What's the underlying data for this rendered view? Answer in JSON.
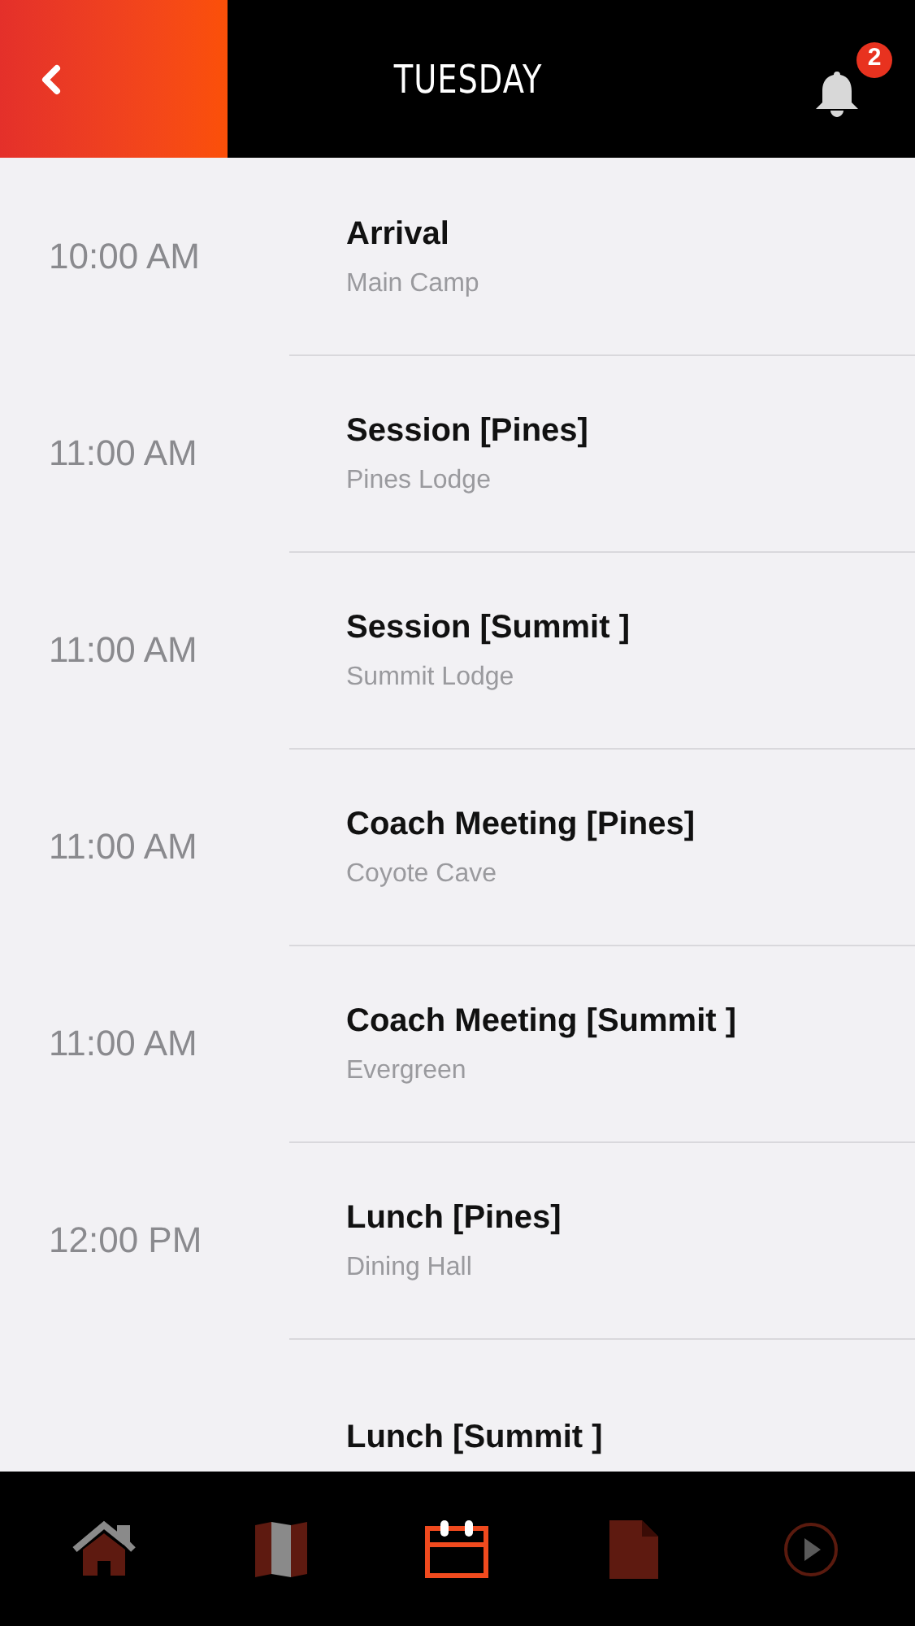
{
  "header": {
    "title": "TUESDAY",
    "notification_count": "2"
  },
  "events": [
    {
      "time": "10:00 AM",
      "title": "Arrival",
      "location": "Main Camp"
    },
    {
      "time": "11:00 AM",
      "title": "Session [Pines]",
      "location": "Pines Lodge"
    },
    {
      "time": "11:00 AM",
      "title": "Session [Summit ]",
      "location": "Summit Lodge"
    },
    {
      "time": "11:00 AM",
      "title": "Coach Meeting [Pines]",
      "location": "Coyote Cave"
    },
    {
      "time": "11:00 AM",
      "title": "Coach Meeting [Summit ]",
      "location": "Evergreen"
    },
    {
      "time": "12:00 PM",
      "title": "Lunch [Pines]",
      "location": "Dining Hall"
    },
    {
      "title": "Lunch [Summit ]"
    }
  ],
  "tab_bar": [
    {
      "kind": "home",
      "selected": false
    },
    {
      "kind": "map",
      "selected": false
    },
    {
      "kind": "calendar",
      "selected": true
    },
    {
      "kind": "document",
      "selected": false
    },
    {
      "kind": "play",
      "selected": false
    }
  ]
}
